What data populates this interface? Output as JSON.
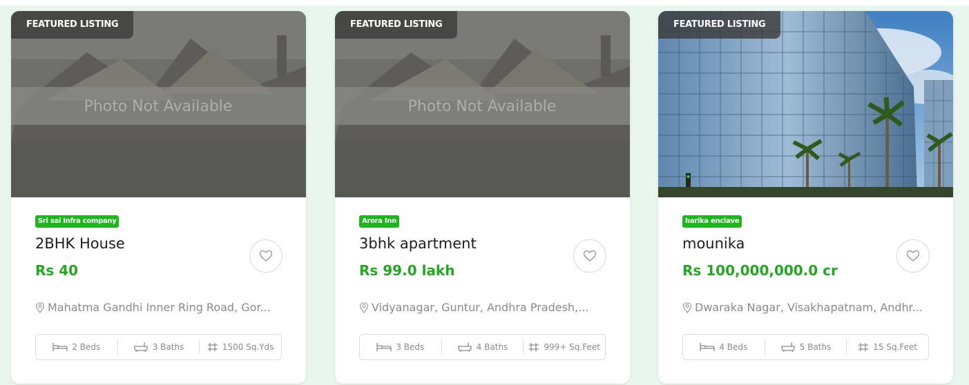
{
  "featured_label": "FEATURED LISTING",
  "photo_placeholder": "Photo Not Available",
  "cards": [
    {
      "company": "Sri sai Infra company",
      "title": "2BHK House",
      "price": "Rs 40",
      "location": "Mahatma Gandhi Inner Ring Road, Gor...",
      "beds": "2 Beds",
      "baths": "3 Baths",
      "area": "1500 Sq.Yds",
      "has_photo": false
    },
    {
      "company": "Arora Inn",
      "title": "3bhk apartment",
      "price": "Rs 99.0 lakh",
      "location": "Vidyanagar, Guntur, Andhra Pradesh,...",
      "beds": "3 Beds",
      "baths": "4 Baths",
      "area": "999+ Sq.Feet",
      "has_photo": false
    },
    {
      "company": "harika enclave",
      "title": "mounika",
      "price": "Rs 100,000,000.0 cr",
      "location": "Dwaraka Nagar, Visakhapatnam, Andhr...",
      "beds": "4 Beds",
      "baths": "5 Baths",
      "area": "15 Sq.Feet",
      "has_photo": true
    }
  ],
  "colors": {
    "accent_green": "#22a81f",
    "badge_green": "#1fb51f",
    "page_bg": "#e8f6ee"
  },
  "icons": [
    "location-pin-icon",
    "bed-icon",
    "bath-icon",
    "area-icon",
    "heart-icon"
  ]
}
